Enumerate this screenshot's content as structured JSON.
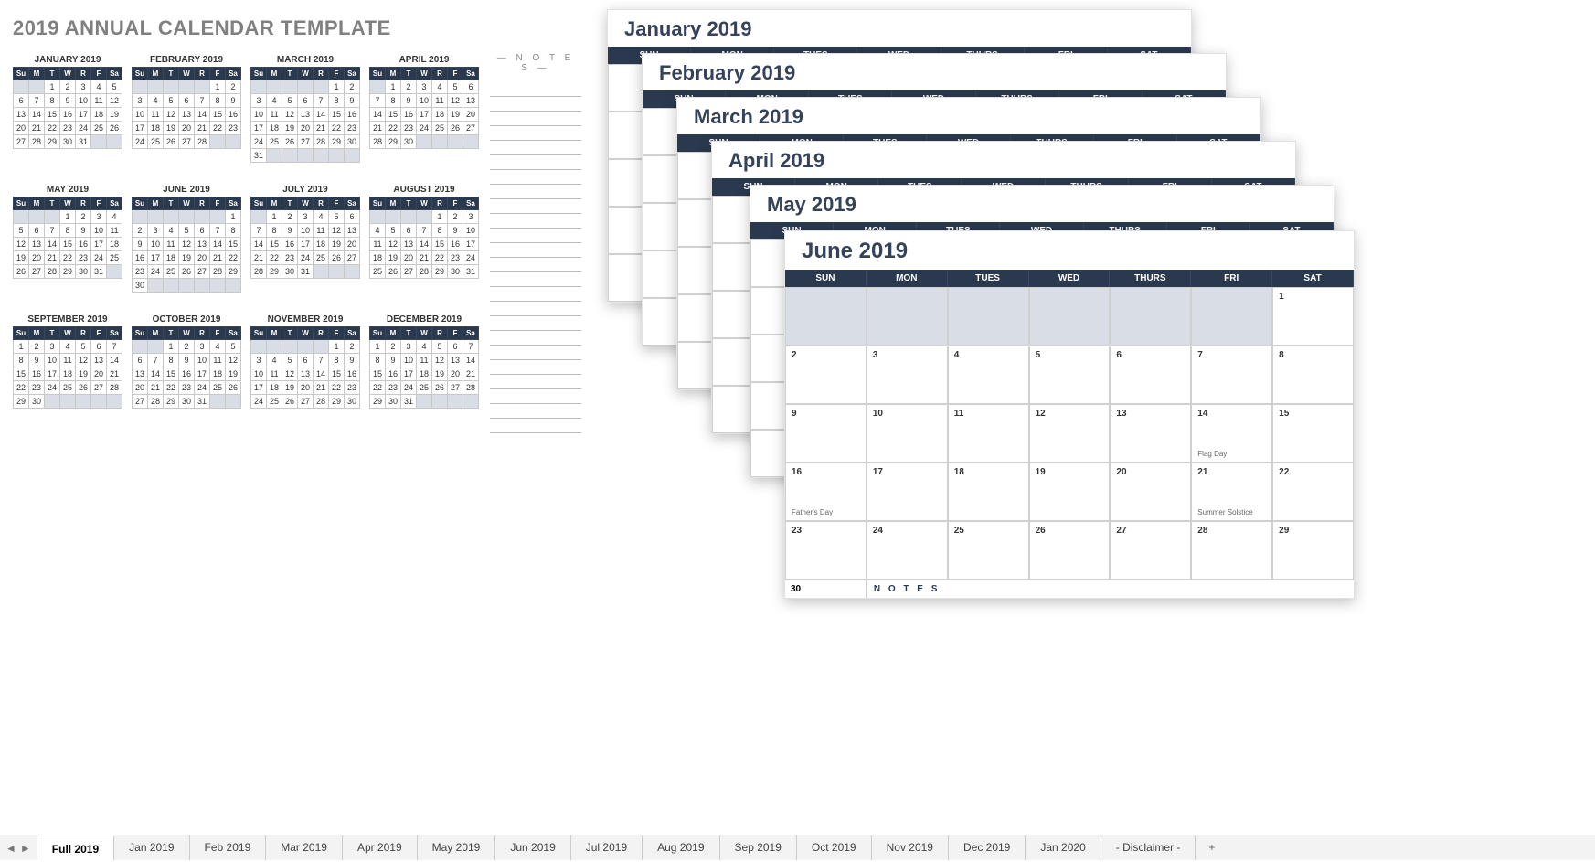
{
  "title": "2019 ANNUAL CALENDAR TEMPLATE",
  "dow_short": [
    "Su",
    "M",
    "T",
    "W",
    "R",
    "F",
    "Sa"
  ],
  "dow_long": [
    "SUN",
    "MON",
    "TUES",
    "WED",
    "THURS",
    "FRI",
    "SAT"
  ],
  "notes_heading": "— N O T E S —",
  "mini_months": [
    {
      "name": "JANUARY 2019",
      "start": 2,
      "days": 31
    },
    {
      "name": "FEBRUARY 2019",
      "start": 5,
      "days": 28
    },
    {
      "name": "MARCH 2019",
      "start": 5,
      "days": 31
    },
    {
      "name": "APRIL 2019",
      "start": 1,
      "days": 30
    },
    {
      "name": "MAY 2019",
      "start": 3,
      "days": 31
    },
    {
      "name": "JUNE 2019",
      "start": 6,
      "days": 30
    },
    {
      "name": "JULY 2019",
      "start": 1,
      "days": 31
    },
    {
      "name": "AUGUST 2019",
      "start": 4,
      "days": 31
    },
    {
      "name": "SEPTEMBER 2019",
      "start": 0,
      "days": 30
    },
    {
      "name": "OCTOBER 2019",
      "start": 2,
      "days": 31
    },
    {
      "name": "NOVEMBER 2019",
      "start": 5,
      "days": 30
    },
    {
      "name": "DECEMBER 2019",
      "start": 0,
      "days": 31
    }
  ],
  "stack": [
    {
      "cls": "jan",
      "title": "January 2019"
    },
    {
      "cls": "feb",
      "title": "February 2019"
    },
    {
      "cls": "mar",
      "title": "March 2019"
    },
    {
      "cls": "apr",
      "title": "April 2019"
    },
    {
      "cls": "may",
      "title": "May 2019"
    }
  ],
  "june": {
    "title": "June 2019",
    "start": 6,
    "days": 30,
    "events": {
      "14": "Flag Day",
      "16": "Father's Day",
      "21": "Summer Solstice"
    },
    "notes_label": "N O T E S"
  },
  "tabs": [
    "Full 2019",
    "Jan 2019",
    "Feb 2019",
    "Mar 2019",
    "Apr 2019",
    "May 2019",
    "Jun 2019",
    "Jul 2019",
    "Aug 2019",
    "Sep 2019",
    "Oct 2019",
    "Nov 2019",
    "Dec 2019",
    "Jan 2020",
    "- Disclaimer -"
  ],
  "active_tab": "Full 2019",
  "add_tab": "+"
}
